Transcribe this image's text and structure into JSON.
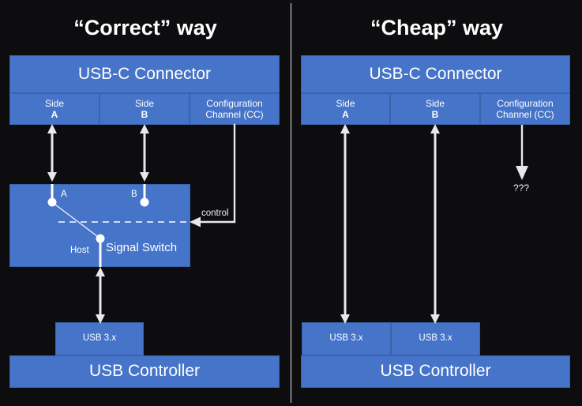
{
  "diagram": {
    "background_color": "#0d0d0f",
    "box_color": "#4674c9",
    "line_color": "#e8e8ea",
    "text_color": "#ffffff"
  },
  "panels": [
    {
      "id": "correct",
      "title": "“Correct” way",
      "connector": {
        "title": "USB-C Connector",
        "segments": [
          {
            "line1": "Side",
            "line2": "A"
          },
          {
            "line1": "Side",
            "line2": "B"
          },
          {
            "line1": "Configuration",
            "line2": "Channel (CC)"
          }
        ]
      },
      "switch": {
        "title": "Signal Switch",
        "node_a": "A",
        "node_b": "B",
        "node_host": "Host",
        "control_label": "control"
      },
      "ports": [
        {
          "label": "USB 3.x"
        }
      ],
      "controller": {
        "title": "USB Controller"
      }
    },
    {
      "id": "cheap",
      "title": "“Cheap” way",
      "connector": {
        "title": "USB-C Connector",
        "segments": [
          {
            "line1": "Side",
            "line2": "A"
          },
          {
            "line1": "Side",
            "line2": "B"
          },
          {
            "line1": "Configuration",
            "line2": "Channel (CC)"
          }
        ]
      },
      "cc_unknown": "???",
      "ports": [
        {
          "label": "USB 3.x"
        },
        {
          "label": "USB 3.x"
        }
      ],
      "controller": {
        "title": "USB Controller"
      }
    }
  ]
}
